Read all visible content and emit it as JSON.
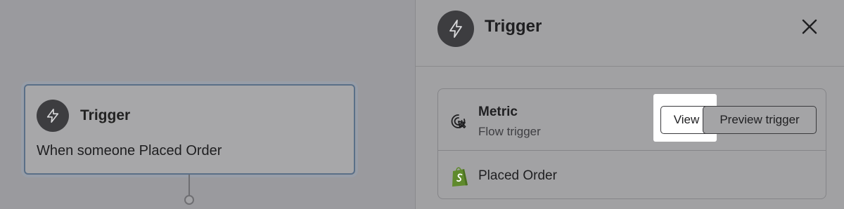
{
  "canvas": {
    "node": {
      "icon": "lightning-icon",
      "title": "Trigger",
      "description": "When someone Placed Order"
    }
  },
  "panel": {
    "icon": "lightning-icon",
    "title": "Trigger",
    "close_icon": "close-icon",
    "metric": {
      "icon": "cursor-click-icon",
      "title": "Metric",
      "subtitle": "Flow trigger",
      "view_label": "View",
      "preview_label": "Preview trigger"
    },
    "source": {
      "icon": "shopify-icon",
      "label": "Placed Order"
    }
  },
  "colors": {
    "overlay_gray": "#a1a1a3",
    "icon_circle": "#3d3d40",
    "node_border": "#5a6f87",
    "shopify_green": "#5f8a2c"
  }
}
